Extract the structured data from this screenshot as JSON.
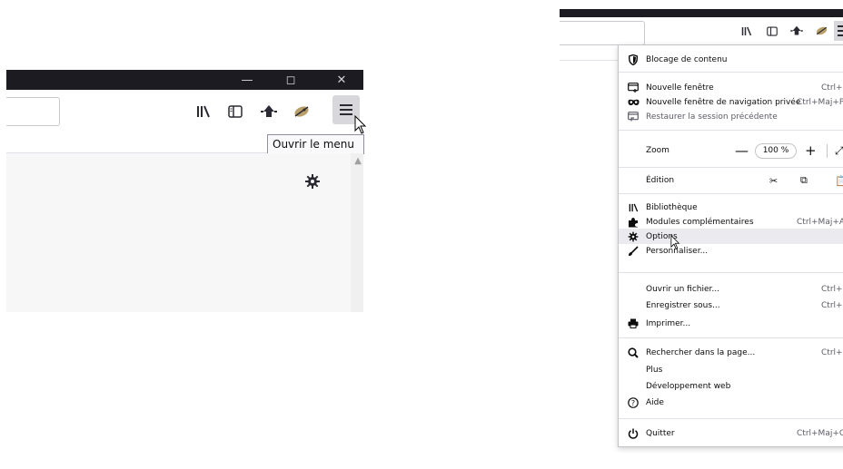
{
  "left": {
    "window_controls": [
      "—",
      "◻",
      "✕"
    ],
    "tooltip": "Ouvrir le menu",
    "icons": [
      "library-icon",
      "sidebar-icon",
      "pocket-icon",
      "extension-icon",
      "menu-icon",
      "gear-icon"
    ]
  },
  "menu": {
    "blocking": "Blocage de contenu",
    "new_window": "Nouvelle fenêtre",
    "new_window_shortcut": "Ctrl+N",
    "new_private": "Nouvelle fenêtre de navigation privée",
    "new_private_shortcut": "Ctrl+Maj+P",
    "restore": "Restaurer la session précédente",
    "zoom_label": "Zoom",
    "zoom_minus": "—",
    "zoom_value": "100 %",
    "zoom_plus": "+",
    "edit_label": "Édition",
    "library": "Bibliothèque",
    "addons": "Modules complémentaires",
    "addons_shortcut": "Ctrl+Maj+A",
    "options": "Options",
    "customize": "Personnaliser...",
    "open_file": "Ouvrir un fichier...",
    "open_file_shortcut": "Ctrl+O",
    "save_as": "Enregistrer sous...",
    "save_as_shortcut": "Ctrl+S",
    "print": "Imprimer...",
    "find": "Rechercher dans la page...",
    "find_shortcut": "Ctrl+F",
    "more": "Plus",
    "webdev": "Développement web",
    "help": "Aide",
    "quit": "Quitter",
    "quit_shortcut": "Ctrl+Maj+Q",
    "arrow": "›"
  },
  "colors": {
    "titlebar": "#1c1b22",
    "hover": "#ebebef",
    "tooltip_bg": "#f9f9fb"
  }
}
